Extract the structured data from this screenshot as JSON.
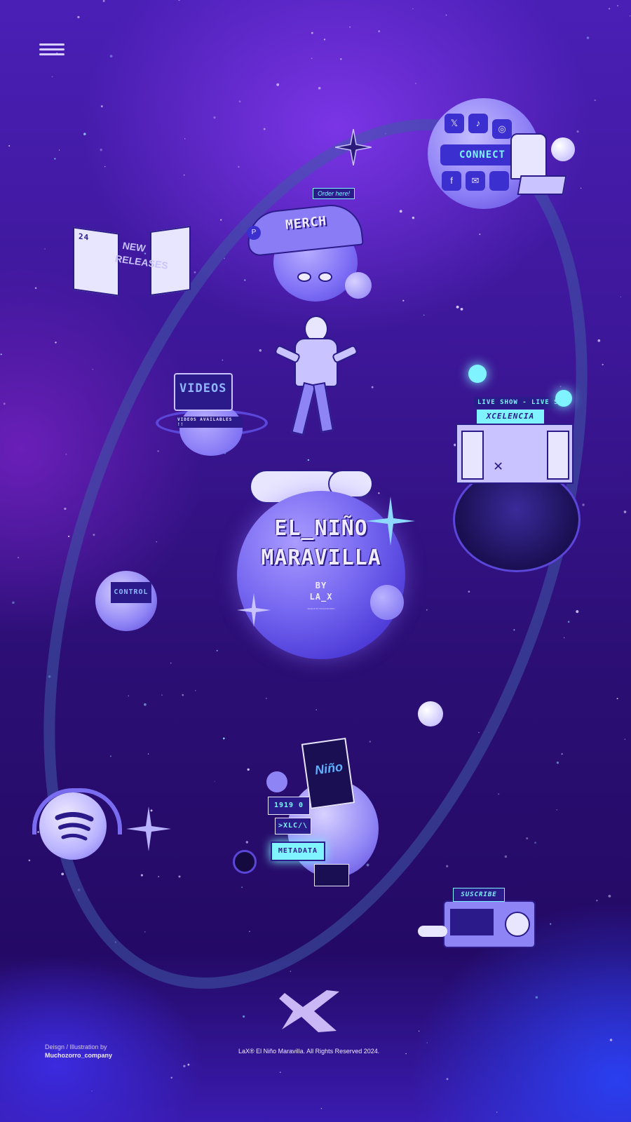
{
  "menu": {
    "icon": "hamburger-menu-icon"
  },
  "hero": {
    "title_line1": "EL_NIÑO",
    "title_line2": "MARAVILLA",
    "by": "BY",
    "artist": "LA_X",
    "tiny_credit": "DESIGN BY MUCHOZORRO"
  },
  "nav": {
    "merch_label": "MERCH",
    "order_label": "Order here!",
    "connect_label": "CONNECT",
    "releases_label": "NEW RELEASES",
    "releases_number": "24",
    "videos_label": "VIDEOS",
    "videos_sub": "VIDEOS AVAILABLES !!",
    "live_banner": "LIVE SHOW - LIVE SH",
    "live_sign": "XCELENCIA",
    "control_label": "CONTROL",
    "metadata_label": "METADATA",
    "metadata_date": "1919 0",
    "metadata_xlc": ">XLC/\\",
    "nino_sign": "Niño",
    "subscribe_label": "SUSCRIBE"
  },
  "social_icons": [
    "x-icon",
    "tiktok-icon",
    "instagram-icon",
    "facebook-icon",
    "mail-icon",
    "blank-icon"
  ],
  "footer": {
    "credit_label": "Deisgn / Illustration by",
    "credit_name": "Muchozorro_company",
    "copyright": "LaX® El Niño Maravilla. All Rights Reserved 2024.",
    "logo": "lax-logo"
  },
  "colors": {
    "bg_top": "#4a1fb6",
    "bg_mid": "#2b0e73",
    "accent_cyan": "#5ff0ff",
    "planet": "#7566f0",
    "text": "#f0eaff"
  }
}
